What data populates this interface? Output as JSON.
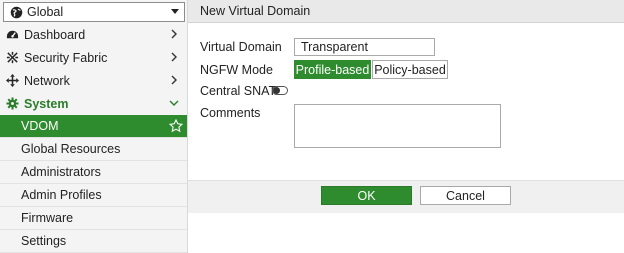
{
  "sidebar": {
    "vdom_select": {
      "value": "Global",
      "icon": "globe-icon"
    },
    "items": [
      {
        "label": "Dashboard",
        "icon": "dashboard-icon"
      },
      {
        "label": "Security Fabric",
        "icon": "security-fabric-icon"
      },
      {
        "label": "Network",
        "icon": "network-icon"
      },
      {
        "label": "System",
        "icon": "gear-icon"
      }
    ],
    "subitems": [
      {
        "label": "VDOM"
      },
      {
        "label": "Global Resources"
      },
      {
        "label": "Administrators"
      },
      {
        "label": "Admin Profiles"
      },
      {
        "label": "Firmware"
      },
      {
        "label": "Settings"
      }
    ]
  },
  "main": {
    "title": "New Virtual Domain",
    "form": {
      "virtual_domain_label": "Virtual Domain",
      "virtual_domain_value": "Transparent",
      "ngfw_mode_label": "NGFW Mode",
      "ngfw_options": [
        "Profile-based",
        "Policy-based"
      ],
      "ngfw_selected": "Profile-based",
      "central_snat_label": "Central SNAT",
      "central_snat_enabled": false,
      "comments_label": "Comments",
      "comments_value": ""
    },
    "buttons": {
      "ok": "OK",
      "cancel": "Cancel"
    }
  },
  "colors": {
    "accent": "#2e8b2e"
  }
}
